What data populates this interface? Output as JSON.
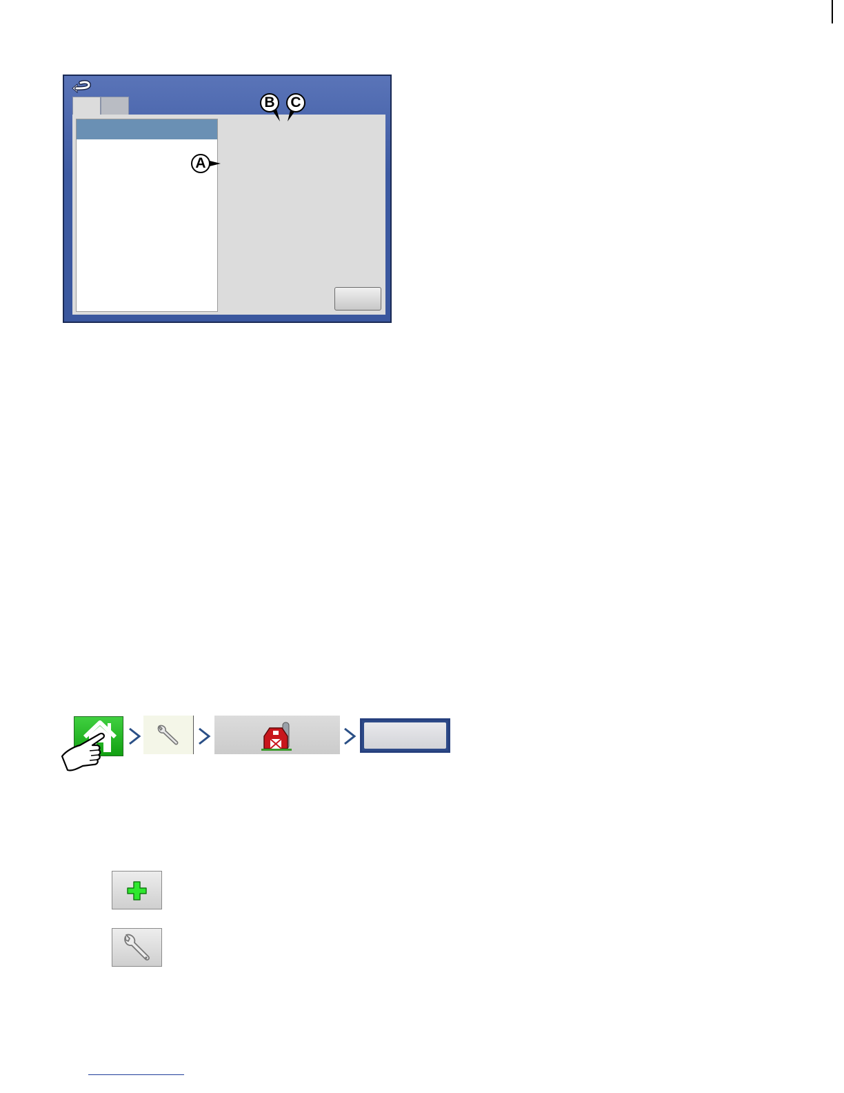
{
  "screenshot": {
    "callouts": {
      "a": "A",
      "b": "B",
      "c": "C"
    }
  },
  "navigation": {
    "steps": [
      "home-icon",
      "wrench-icon",
      "barn-icon",
      "setup-button"
    ]
  },
  "icon_buttons": [
    "plus-icon",
    "wrench-icon"
  ],
  "colors": {
    "screen_frame": "#3d5aa2",
    "list_header": "#6a90b4",
    "home_green": "#22b022",
    "chevron_blue": "#2a4f86"
  }
}
